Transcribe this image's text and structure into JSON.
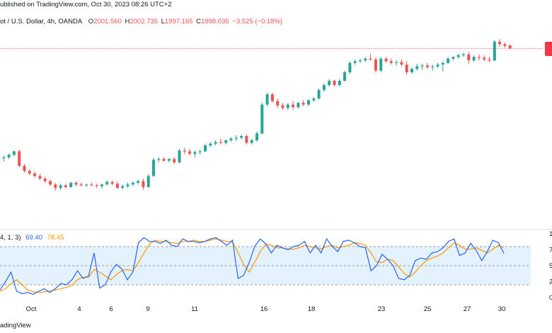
{
  "header": {
    "published": "ublished on TradingView.com, Oct 30, 2023 08:26 UTC+2"
  },
  "legend": {
    "pair": "ot / U.S. Dollar, 4h, OANDA",
    "open_key": "O",
    "open": "2001.560",
    "high_key": "H",
    "high": "2002.735",
    "low_key": "L",
    "low": "1997.165",
    "close_key": "C",
    "close": "1998.035",
    "change": "−3.525 (−0.18%)"
  },
  "oscillator": {
    "params": "4, 1, 3)",
    "k_value": "69.40",
    "d_value": "78.45",
    "scale_labels": [
      "1",
      "7",
      "5",
      "2",
      "0"
    ]
  },
  "footer": {
    "brand": "adingView"
  },
  "x_axis": {
    "labels": [
      "Oct",
      "4",
      "6",
      "9",
      "11",
      "16",
      "18",
      "23",
      "25",
      "27",
      "30"
    ]
  },
  "colors": {
    "up": "#26a69a",
    "down": "#ef5350",
    "k_line": "#2962ff",
    "d_line": "#ff9800",
    "band_fill": "#e3f2fd",
    "price_line": "#f23645"
  },
  "chart_data": [
    {
      "type": "candlestick",
      "title": "",
      "xlabel": "",
      "ylabel": "",
      "x_ticks": [
        "Oct",
        "4",
        "6",
        "9",
        "11",
        "16",
        "18",
        "23",
        "25",
        "27",
        "30"
      ],
      "ylim": [
        1805,
        2015
      ],
      "candles": [
        [
          1872,
          1875,
          1866,
          1869
        ],
        [
          1869,
          1872,
          1865,
          1870
        ],
        [
          1870,
          1874,
          1868,
          1873
        ],
        [
          1873,
          1878,
          1871,
          1877
        ],
        [
          1877,
          1879,
          1858,
          1860
        ],
        [
          1860,
          1862,
          1852,
          1854
        ],
        [
          1854,
          1856,
          1849,
          1851
        ],
        [
          1851,
          1853,
          1846,
          1848
        ],
        [
          1848,
          1850,
          1843,
          1845
        ],
        [
          1845,
          1847,
          1840,
          1842
        ],
        [
          1842,
          1844,
          1836,
          1838
        ],
        [
          1838,
          1840,
          1831,
          1834
        ],
        [
          1834,
          1839,
          1832,
          1837
        ],
        [
          1837,
          1839,
          1833,
          1835
        ],
        [
          1835,
          1841,
          1834,
          1840
        ],
        [
          1840,
          1842,
          1836,
          1838
        ],
        [
          1838,
          1840,
          1836,
          1837
        ],
        [
          1837,
          1839,
          1835,
          1838
        ],
        [
          1838,
          1840,
          1836,
          1837
        ],
        [
          1837,
          1839,
          1834,
          1836
        ],
        [
          1836,
          1839,
          1833,
          1838
        ],
        [
          1838,
          1843,
          1837,
          1841
        ],
        [
          1841,
          1843,
          1837,
          1839
        ],
        [
          1839,
          1841,
          1833,
          1834
        ],
        [
          1834,
          1838,
          1832,
          1836
        ],
        [
          1836,
          1840,
          1834,
          1838
        ],
        [
          1838,
          1842,
          1836,
          1840
        ],
        [
          1840,
          1844,
          1838,
          1842
        ],
        [
          1842,
          1845,
          1832,
          1835
        ],
        [
          1835,
          1850,
          1834,
          1848
        ],
        [
          1848,
          1869,
          1847,
          1867
        ],
        [
          1867,
          1870,
          1864,
          1868
        ],
        [
          1868,
          1870,
          1865,
          1866
        ],
        [
          1866,
          1869,
          1864,
          1868
        ],
        [
          1868,
          1870,
          1862,
          1864
        ],
        [
          1864,
          1880,
          1863,
          1878
        ],
        [
          1878,
          1881,
          1874,
          1877
        ],
        [
          1877,
          1880,
          1872,
          1874
        ],
        [
          1874,
          1878,
          1870,
          1876
        ],
        [
          1876,
          1879,
          1873,
          1877
        ],
        [
          1877,
          1886,
          1876,
          1884
        ],
        [
          1884,
          1888,
          1882,
          1886
        ],
        [
          1886,
          1890,
          1884,
          1888
        ],
        [
          1888,
          1892,
          1885,
          1887
        ],
        [
          1887,
          1891,
          1885,
          1890
        ],
        [
          1890,
          1894,
          1888,
          1892
        ],
        [
          1892,
          1896,
          1889,
          1893
        ],
        [
          1893,
          1897,
          1891,
          1895
        ],
        [
          1895,
          1897,
          1885,
          1887
        ],
        [
          1887,
          1892,
          1885,
          1890
        ],
        [
          1890,
          1900,
          1888,
          1898
        ],
        [
          1898,
          1934,
          1897,
          1932
        ],
        [
          1932,
          1946,
          1930,
          1944
        ],
        [
          1944,
          1946,
          1934,
          1936
        ],
        [
          1936,
          1939,
          1928,
          1931
        ],
        [
          1931,
          1934,
          1926,
          1928
        ],
        [
          1928,
          1934,
          1926,
          1932
        ],
        [
          1932,
          1936,
          1926,
          1929
        ],
        [
          1929,
          1935,
          1927,
          1934
        ],
        [
          1934,
          1937,
          1930,
          1932
        ],
        [
          1932,
          1938,
          1930,
          1937
        ],
        [
          1937,
          1941,
          1935,
          1939
        ],
        [
          1939,
          1951,
          1938,
          1949
        ],
        [
          1949,
          1957,
          1947,
          1955
        ],
        [
          1955,
          1962,
          1953,
          1960
        ],
        [
          1960,
          1961,
          1953,
          1955
        ],
        [
          1955,
          1962,
          1953,
          1960
        ],
        [
          1960,
          1972,
          1959,
          1970
        ],
        [
          1970,
          1983,
          1968,
          1981
        ],
        [
          1981,
          1985,
          1979,
          1983
        ],
        [
          1983,
          1986,
          1981,
          1984
        ],
        [
          1984,
          1988,
          1982,
          1986
        ],
        [
          1986,
          1992,
          1984,
          1985
        ],
        [
          1985,
          1987,
          1970,
          1972
        ],
        [
          1972,
          1988,
          1970,
          1986
        ],
        [
          1986,
          1988,
          1981,
          1983
        ],
        [
          1983,
          1986,
          1979,
          1981
        ],
        [
          1981,
          1984,
          1978,
          1982
        ],
        [
          1982,
          1985,
          1977,
          1979
        ],
        [
          1979,
          1983,
          1967,
          1970
        ],
        [
          1970,
          1976,
          1968,
          1974
        ],
        [
          1974,
          1980,
          1972,
          1977
        ],
        [
          1977,
          1980,
          1973,
          1978
        ],
        [
          1978,
          1981,
          1974,
          1976
        ],
        [
          1976,
          1979,
          1972,
          1977
        ],
        [
          1977,
          1981,
          1975,
          1979
        ],
        [
          1979,
          1983,
          1971,
          1981
        ],
        [
          1981,
          1988,
          1980,
          1986
        ],
        [
          1986,
          1989,
          1984,
          1988
        ],
        [
          1988,
          1992,
          1986,
          1990
        ],
        [
          1990,
          1993,
          1988,
          1991
        ],
        [
          1991,
          1994,
          1980,
          1984
        ],
        [
          1984,
          1990,
          1982,
          1988
        ],
        [
          1988,
          1991,
          1984,
          1987
        ],
        [
          1987,
          1990,
          1983,
          1985
        ],
        [
          1985,
          1988,
          1982,
          1984
        ],
        [
          1984,
          2008,
          1983,
          2006
        ],
        [
          2006,
          2009,
          2000,
          2003
        ],
        [
          2003,
          2005,
          1999,
          2001
        ],
        [
          2001.56,
          2002.735,
          1997.165,
          1998.035
        ]
      ]
    },
    {
      "type": "line",
      "title": "",
      "xlabel": "",
      "ylabel": "",
      "ylim": [
        0,
        100
      ],
      "bands": [
        20,
        50,
        80
      ],
      "series": [
        {
          "values": [
            12,
            25,
            40,
            10,
            6,
            8,
            5,
            10,
            14,
            8,
            14,
            22,
            20,
            28,
            42,
            30,
            34,
            70,
            15,
            20,
            40,
            52,
            45,
            28,
            40,
            86,
            94,
            88,
            88,
            85,
            90,
            82,
            80,
            92,
            88,
            88,
            86,
            88,
            92,
            94,
            88,
            82,
            90,
            30,
            35,
            55,
            80,
            92,
            84,
            70,
            82,
            78,
            75,
            80,
            82,
            88,
            70,
            82,
            70,
            92,
            80,
            72,
            88,
            90,
            86,
            80,
            78,
            42,
            50,
            68,
            60,
            50,
            30,
            28,
            35,
            58,
            62,
            60,
            70,
            72,
            78,
            88,
            92,
            66,
            70,
            85,
            74,
            58,
            72,
            90,
            86,
            69.4
          ]
        },
        {
          "values": [
            10,
            14,
            22,
            28,
            20,
            12,
            9,
            8,
            9,
            10,
            12,
            14,
            16,
            19,
            28,
            32,
            32,
            44,
            40,
            34,
            28,
            36,
            42,
            44,
            42,
            55,
            70,
            84,
            90,
            88,
            88,
            86,
            85,
            88,
            88,
            90,
            88,
            88,
            90,
            92,
            90,
            88,
            87,
            70,
            52,
            40,
            55,
            72,
            84,
            82,
            78,
            78,
            76,
            76,
            78,
            82,
            80,
            78,
            76,
            80,
            82,
            78,
            80,
            82,
            86,
            85,
            82,
            70,
            56,
            55,
            60,
            58,
            48,
            38,
            32,
            40,
            50,
            58,
            62,
            65,
            70,
            78,
            86,
            82,
            76,
            76,
            78,
            74,
            70,
            76,
            82,
            78.45
          ]
        }
      ]
    }
  ]
}
